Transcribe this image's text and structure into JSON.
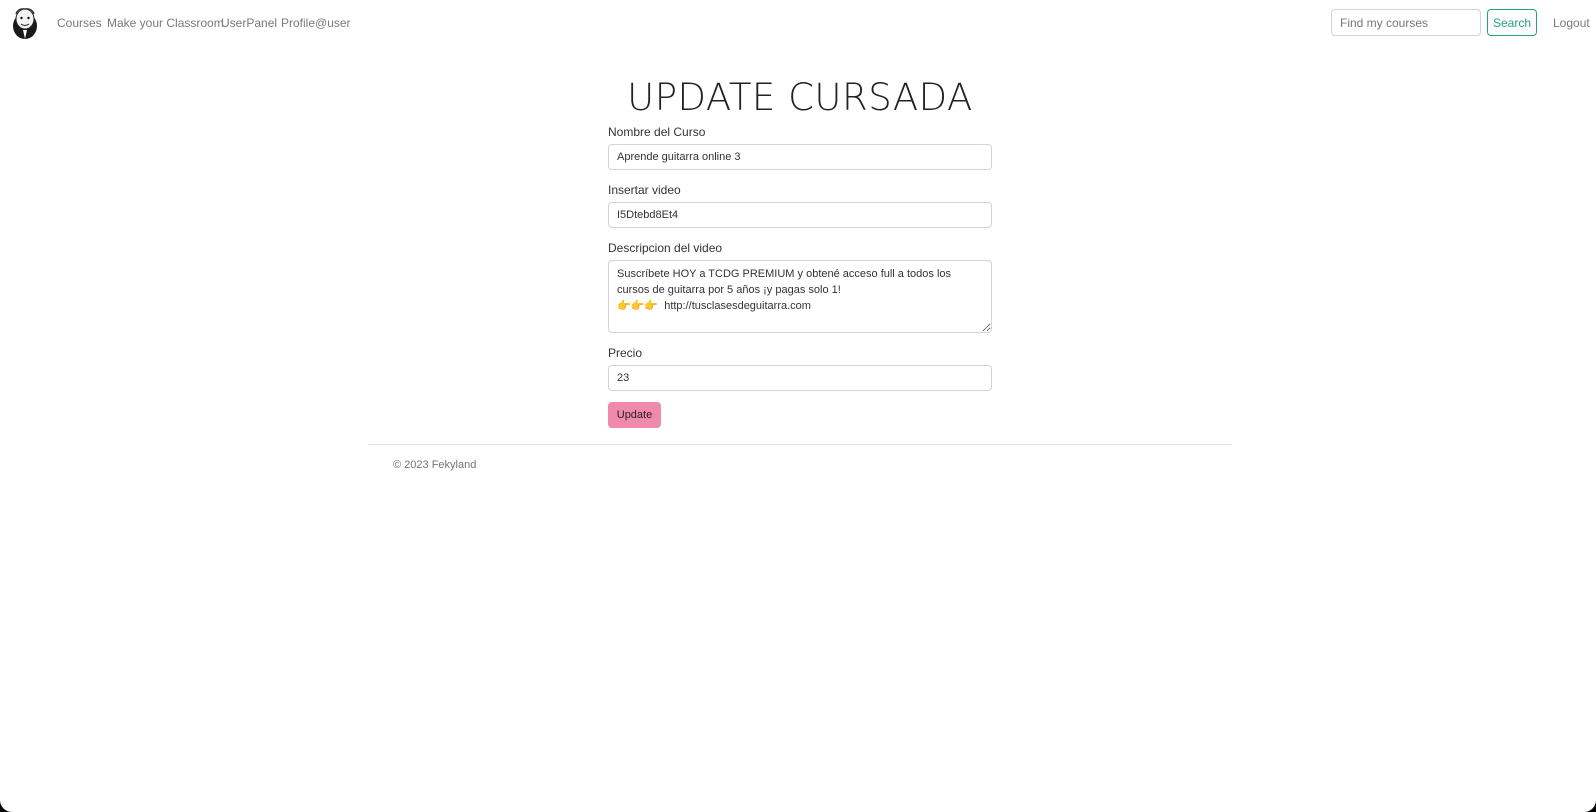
{
  "navbar": {
    "logo_icon": "cartoon-face-logo-icon",
    "links": [
      "Courses",
      "Make your Classroom",
      "UserPanel",
      "Profile@user"
    ],
    "search_placeholder": "Find my courses",
    "search_label": "Search",
    "logout_label": "Logout",
    "accent_color": "#20a57a"
  },
  "form": {
    "title": "UPDATE CURSADA",
    "course_name_label": "Nombre del Curso",
    "course_name_value": "Aprende guitarra online 3",
    "video_label": "Insertar video",
    "video_value": "I5Dtebd8Et4",
    "description_label": "Descripcion del video",
    "description_value": "Suscríbete HOY a TCDG PREMIUM y obtené acceso full a todos los cursos de guitarra por 5 años ¡y pagas solo 1!\n👉👉👉  http://tusclasesdeguitarra.com",
    "price_label": "Precio",
    "price_value": "23",
    "update_label": "Update",
    "update_color": "#f08aac"
  },
  "footer": {
    "copyright": "© 2023 Fekyland"
  }
}
